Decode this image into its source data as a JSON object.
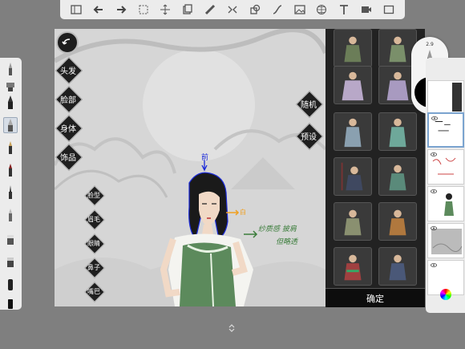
{
  "top_toolbar": {
    "tools": [
      "sidebar-icon",
      "undo-icon",
      "redo-icon",
      "selection-icon",
      "transform-icon",
      "copy-icon",
      "ruler-icon",
      "symmetry-icon",
      "shape-icon",
      "curve-icon",
      "image-icon",
      "perspective-icon",
      "text-icon",
      "video-icon",
      "fullscreen-icon"
    ]
  },
  "side_menu": {
    "hair": "头发",
    "face": "脸部",
    "body": "身体",
    "accessory": "饰品"
  },
  "face_menu": {
    "face_shape": "脸型",
    "eyebrow": "眉毛",
    "eyes": "眼睛",
    "nose": "鼻子",
    "mouth": "嘴巴"
  },
  "actions": {
    "random": "随机",
    "preset": "预设",
    "confirm": "确定"
  },
  "annotations": {
    "front": "前",
    "white": "白",
    "note_line1": "纱质感 披肩",
    "note_line2": "但略透"
  },
  "brush_puck": {
    "size": "2.9"
  },
  "colors": {
    "ui_light": "#ececec",
    "panel_dark": "#222222",
    "canvas_bg": "#d4d4d4",
    "dress_green": "#5c8a5c",
    "annotation_green": "#3b7d3b",
    "hair_outline_blue": "#1c2bd9",
    "annotation_orange": "#f0a020"
  }
}
